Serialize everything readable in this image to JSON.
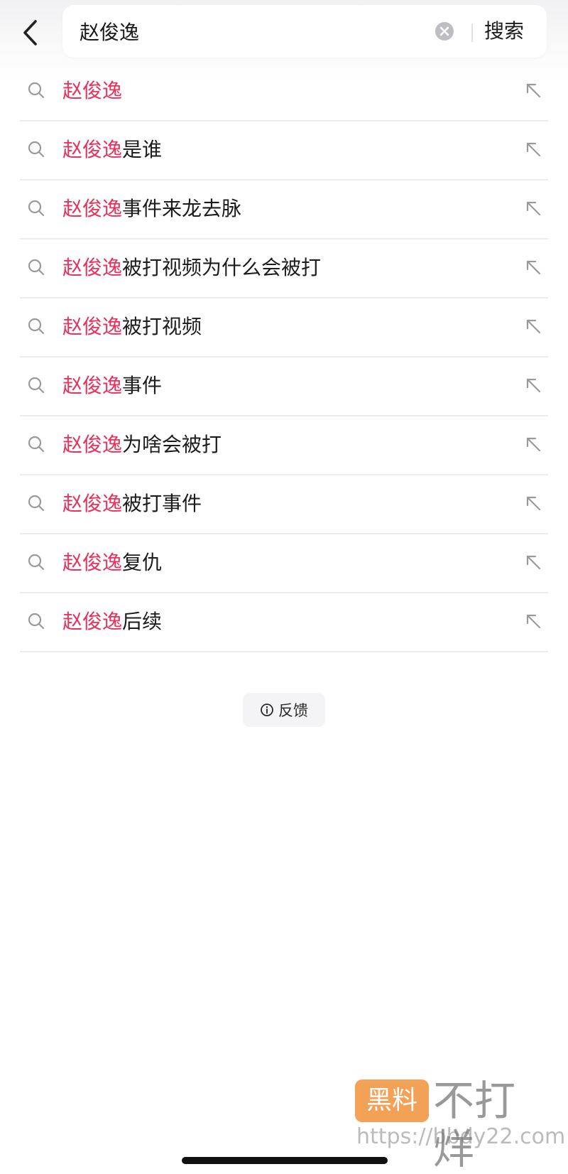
{
  "search": {
    "value": "赵俊逸",
    "submit_label": "搜索"
  },
  "suggestions": [
    {
      "highlight": "赵俊逸",
      "rest": ""
    },
    {
      "highlight": "赵俊逸",
      "rest": "是谁"
    },
    {
      "highlight": "赵俊逸",
      "rest": "事件来龙去脉"
    },
    {
      "highlight": "赵俊逸",
      "rest": "被打视频为什么会被打"
    },
    {
      "highlight": "赵俊逸",
      "rest": "被打视频"
    },
    {
      "highlight": "赵俊逸",
      "rest": "事件"
    },
    {
      "highlight": "赵俊逸",
      "rest": "为啥会被打"
    },
    {
      "highlight": "赵俊逸",
      "rest": "被打事件"
    },
    {
      "highlight": "赵俊逸",
      "rest": "复仇"
    },
    {
      "highlight": "赵俊逸",
      "rest": "后续"
    }
  ],
  "feedback": {
    "label": "反馈"
  },
  "watermark": {
    "badge": "黑料",
    "text": "不打烊",
    "url": "https://bbdy22.com"
  },
  "colors": {
    "highlight": "#e8325b",
    "text": "#1c1c1c",
    "watermark_badge": "#f08b2c"
  },
  "icons": {
    "back": "chevron-left-icon",
    "clear": "clear-circle-icon",
    "suggestion": "search-icon",
    "fill": "arrow-up-left-icon",
    "feedback": "info-icon"
  }
}
